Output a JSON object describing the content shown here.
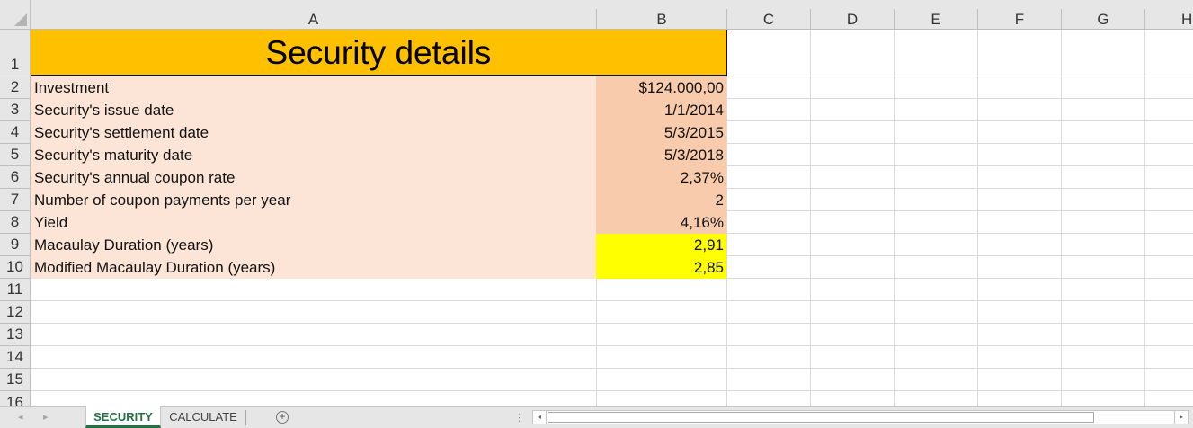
{
  "columns": [
    "A",
    "B",
    "C",
    "D",
    "E",
    "F",
    "G",
    "H"
  ],
  "row_numbers": [
    "1",
    "2",
    "3",
    "4",
    "5",
    "6",
    "7",
    "8",
    "9",
    "10",
    "11",
    "12",
    "13",
    "14",
    "15",
    "16"
  ],
  "title": "Security details",
  "rows": [
    {
      "label": "Investment",
      "value": "$124.000,00"
    },
    {
      "label": "Security's issue date",
      "value": "1/1/2014"
    },
    {
      "label": "Security's settlement date",
      "value": "5/3/2015"
    },
    {
      "label": "Security's maturity date",
      "value": "5/3/2018"
    },
    {
      "label": "Security's annual coupon rate",
      "value": "2,37%"
    },
    {
      "label": "Number of coupon payments per year",
      "value": "2"
    },
    {
      "label": "Yield",
      "value": "4,16%"
    },
    {
      "label": "Macaulay Duration (years)",
      "value": "2,91"
    },
    {
      "label": "Modified Macaulay Duration (years)",
      "value": "2,85"
    }
  ],
  "colors": {
    "title_fill": "#ffc000",
    "label_fill": "#fce4d6",
    "value_fill": "#f8cbad",
    "result_fill": "#ffff00",
    "active_tab": "#217346"
  },
  "sheet_tabs": [
    {
      "label": "SECURITY",
      "active": true
    },
    {
      "label": "CALCULATE",
      "active": false
    }
  ],
  "icons": {
    "tab_nav_left": "triangle-left",
    "tab_nav_right": "triangle-right",
    "add_sheet": "plus-circle",
    "scroll_left": "triangle-left",
    "scroll_right": "triangle-right",
    "select_all": "corner-triangle"
  },
  "glyphs": {
    "add": "+",
    "nav_left": "◂",
    "nav_right": "▸",
    "split": "⋮"
  }
}
